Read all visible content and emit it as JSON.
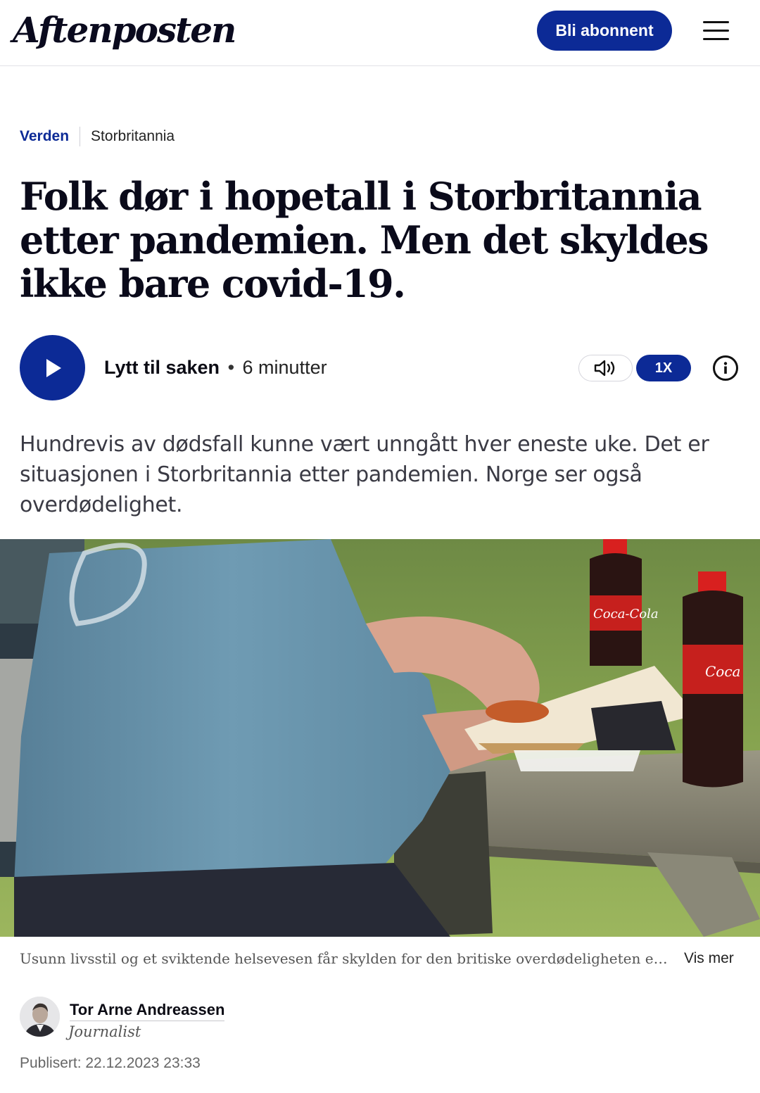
{
  "header": {
    "logo": "Aftenposten",
    "subscribe_label": "Bli abonnent",
    "menu_icon": "hamburger-menu-icon"
  },
  "breadcrumb": {
    "section": "Verden",
    "subsection": "Storbritannia"
  },
  "article": {
    "headline": "Folk dør i hopetall i Storbritannia etter pandemien. Men det skyldes ikke bare covid-19.",
    "lead": "Hundrevis av dødsfall kunne vært unngått hver eneste uke. Det er situasjonen i Storbritannia etter pandemien. Norge ser også overdødelighet.",
    "caption": "Usunn livsstil og et sviktende helsevesen får skylden for den britiske overdødeligheten etter pandemien.",
    "caption_more": "Vis mer",
    "published": "Publisert: 22.12.2023 23:33"
  },
  "audio": {
    "label": "Lytt til saken",
    "separator": "•",
    "duration": "6 minutter",
    "speed": "1X",
    "icons": [
      "play-icon",
      "speaker-icon",
      "info-icon"
    ]
  },
  "author": {
    "name": "Tor Arne Andreassen",
    "role": "Journalist"
  },
  "colors": {
    "brand_blue": "#0c2a96",
    "text": "#0b0b14",
    "muted": "#555555"
  }
}
